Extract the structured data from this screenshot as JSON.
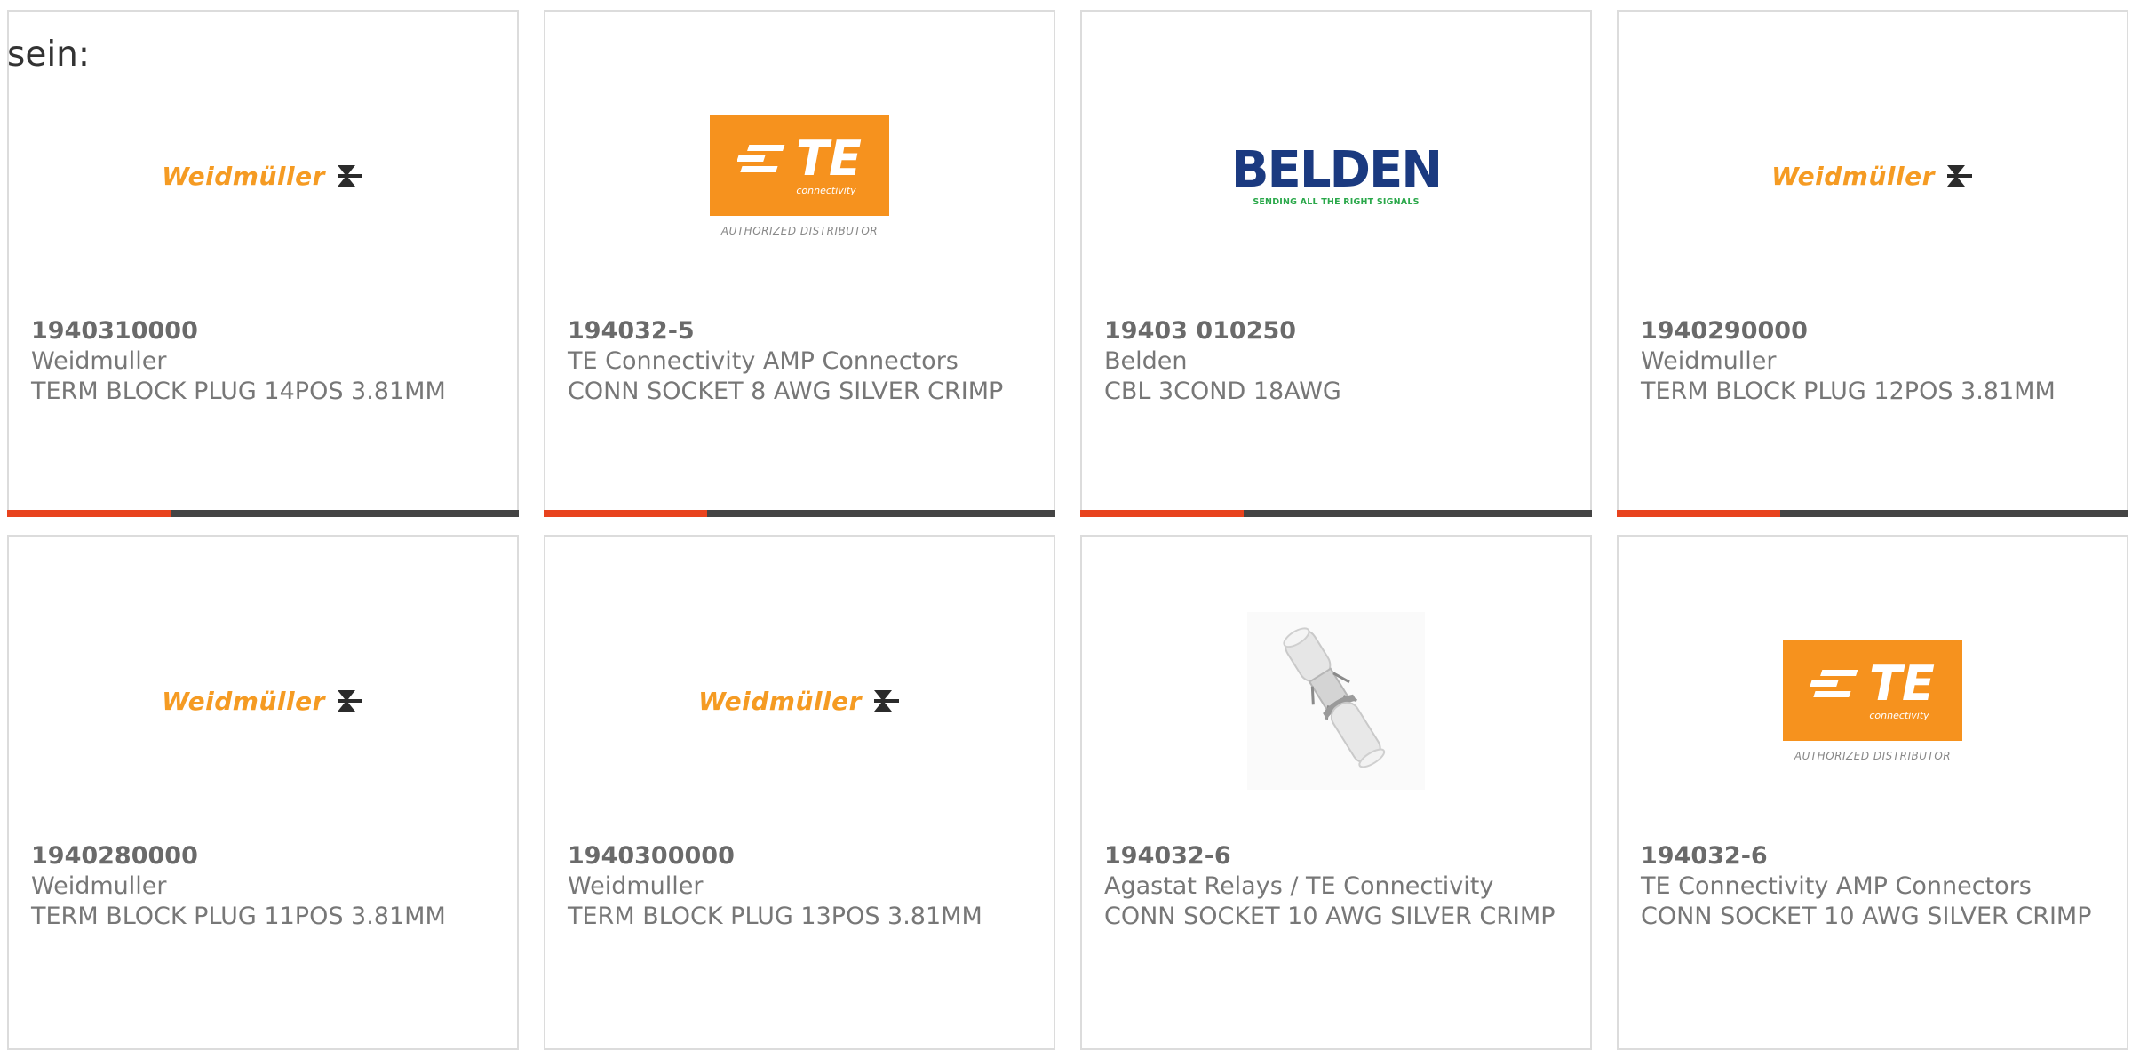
{
  "intro_text": "sein:",
  "accent_color": "#e8431e",
  "bar_color": "#444444",
  "products": [
    {
      "part_number": "1940310000",
      "manufacturer": "Weidmuller",
      "description": "TERM BLOCK PLUG 14POS 3.81MM",
      "logo": "weidmuller-logo",
      "logo_text": "Weidmüller",
      "bar_fill_fraction": 0.32
    },
    {
      "part_number": "194032-5",
      "manufacturer": "TE Connectivity AMP Connectors",
      "description": "CONN SOCKET 8 AWG SILVER CRIMP",
      "logo": "te-connectivity-logo",
      "logo_text": "TE",
      "logo_subtext": "connectivity",
      "logo_caption": "AUTHORIZED DISTRIBUTOR",
      "bar_fill_fraction": 0.32
    },
    {
      "part_number": "19403 010250",
      "manufacturer": "Belden",
      "description": "CBL 3COND 18AWG",
      "logo": "belden-logo",
      "logo_text": "BELDEN",
      "logo_subtext": "SENDING ALL THE RIGHT SIGNALS",
      "bar_fill_fraction": 0.32
    },
    {
      "part_number": "1940290000",
      "manufacturer": "Weidmuller",
      "description": "TERM BLOCK PLUG 12POS 3.81MM",
      "logo": "weidmuller-logo",
      "logo_text": "Weidmüller",
      "bar_fill_fraction": 0.32
    },
    {
      "part_number": "1940280000",
      "manufacturer": "Weidmuller",
      "description": "TERM BLOCK PLUG 11POS 3.81MM",
      "logo": "weidmuller-logo",
      "logo_text": "Weidmüller"
    },
    {
      "part_number": "1940300000",
      "manufacturer": "Weidmuller",
      "description": "TERM BLOCK PLUG 13POS 3.81MM",
      "logo": "weidmuller-logo",
      "logo_text": "Weidmüller"
    },
    {
      "part_number": "194032-6",
      "manufacturer": "Agastat Relays / TE Connectivity",
      "description": "CONN SOCKET 10 AWG SILVER CRIMP",
      "logo": "crimp-socket-photo"
    },
    {
      "part_number": "194032-6",
      "manufacturer": "TE Connectivity AMP Connectors",
      "description": "CONN SOCKET 10 AWG SILVER CRIMP",
      "logo": "te-connectivity-logo",
      "logo_text": "TE",
      "logo_subtext": "connectivity",
      "logo_caption": "AUTHORIZED DISTRIBUTOR"
    }
  ]
}
